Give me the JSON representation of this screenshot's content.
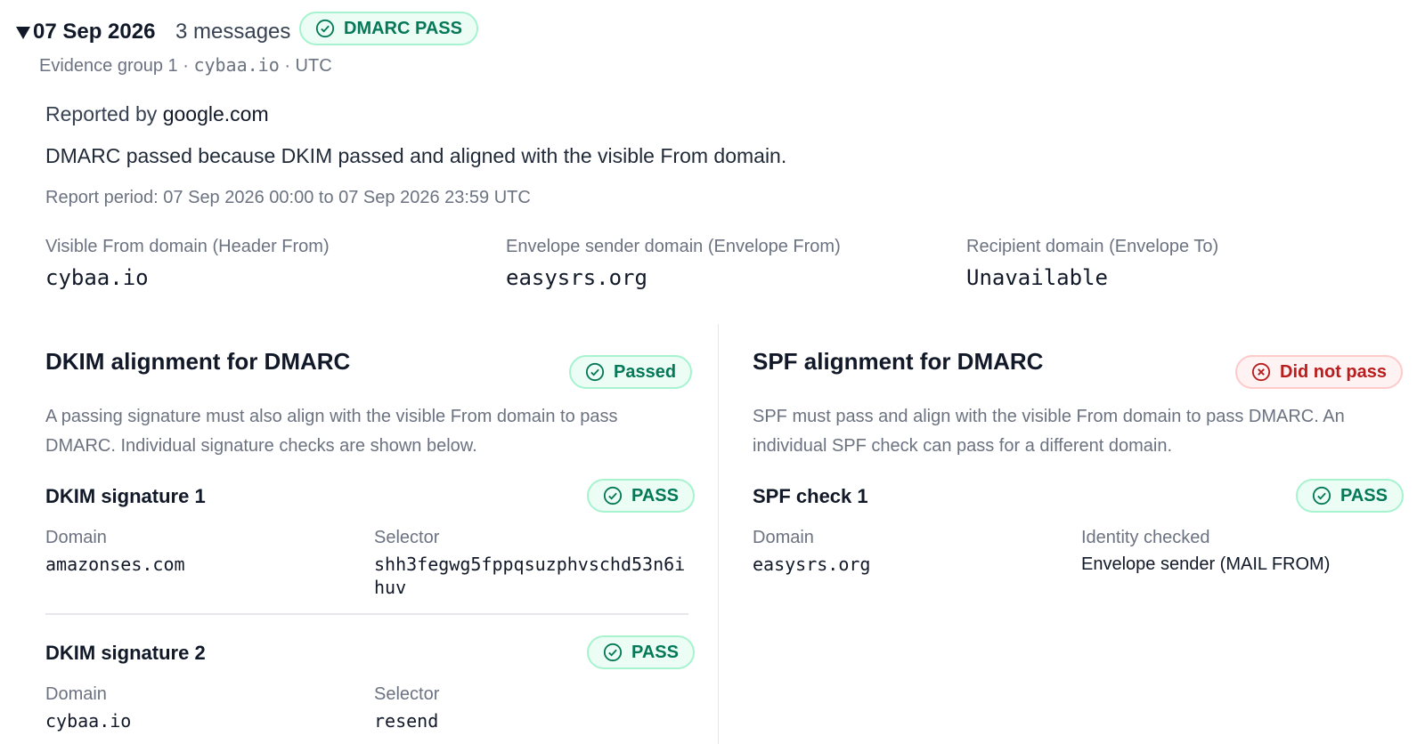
{
  "group": {
    "date": "07 Sep 2026",
    "message_count": "3 messages",
    "dmarc_badge": "DMARC PASS",
    "meta_prefix": "Evidence group 1 · ",
    "meta_domain": "cybaa.io",
    "meta_suffix": " · UTC"
  },
  "summary": {
    "reported_prefix": "Reported by ",
    "reporter": "google.com",
    "explanation": "DMARC passed because DKIM passed and aligned with the visible From domain.",
    "period": "Report period: 07 Sep 2026 00:00 to 07 Sep 2026 23:59 UTC"
  },
  "domains": {
    "header_from_label": "Visible From domain (Header From)",
    "header_from_value": "cybaa.io",
    "envelope_from_label": "Envelope sender domain (Envelope From)",
    "envelope_from_value": "easysrs.org",
    "envelope_to_label": "Recipient domain (Envelope To)",
    "envelope_to_value": "Unavailable"
  },
  "dkim": {
    "title": "DKIM alignment for DMARC",
    "status": "Passed",
    "description": "A passing signature must also align with the visible From domain to pass DMARC. Individual signature checks are shown below.",
    "signatures": [
      {
        "title": "DKIM signature 1",
        "result": "PASS",
        "domain_label": "Domain",
        "domain": "amazonses.com",
        "selector_label": "Selector",
        "selector_line1": "shh3fegwg5fppqsuzphvschd53n6i",
        "selector_line2": "huv"
      },
      {
        "title": "DKIM signature 2",
        "result": "PASS",
        "domain_label": "Domain",
        "domain": "cybaa.io",
        "selector_label": "Selector",
        "selector_line1": "resend"
      }
    ]
  },
  "spf": {
    "title": "SPF alignment for DMARC",
    "status": "Did not pass",
    "description": "SPF must pass and align with the visible From domain to pass DMARC. An individual SPF check can pass for a different domain.",
    "checks": [
      {
        "title": "SPF check 1",
        "result": "PASS",
        "domain_label": "Domain",
        "domain": "easysrs.org",
        "identity_label": "Identity checked",
        "identity": "Envelope sender (MAIL FROM)"
      }
    ]
  },
  "icons": {
    "pass": "check-circle-icon",
    "fail": "x-circle-icon",
    "expand": "caret-down-icon"
  },
  "colors": {
    "pass_text": "#047857",
    "pass_bg": "#ecfdf5",
    "fail_text": "#b91c1c",
    "fail_bg": "#fef2f2"
  }
}
